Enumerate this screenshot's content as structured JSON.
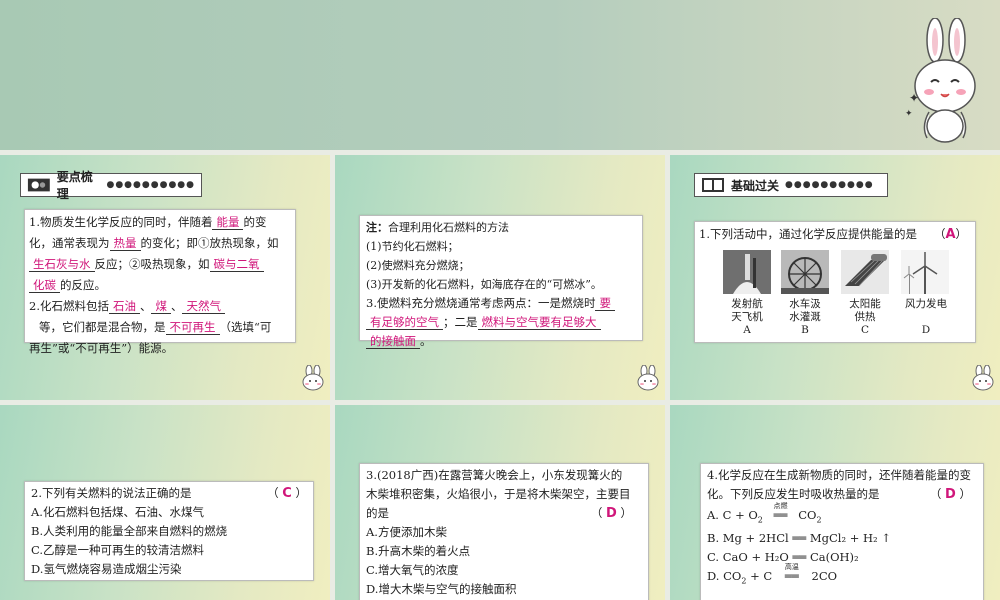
{
  "slide1": {
    "header": "要点梳理",
    "q1_pre": "1.物质发生化学反应的同时，伴随着",
    "q1_a1": "能量",
    "q1_mid1": "的变",
    "q1_line2_pre": "化，通常表现为",
    "q1_a2": "热量",
    "q1_line2_post": "的变化；即①放热现象，如",
    "q1_a3": "生石灰与水",
    "q1_line3_post": "反应；②吸热现象，如",
    "q1_a4": "碳与二氧",
    "q1_a4b": "化碳",
    "q1_line4_post": "的反应。",
    "q2_pre": "2.化石燃料包括",
    "q2_a1": "石油",
    "q2_sep1": "、",
    "q2_a2": "煤",
    "q2_sep2": "、",
    "q2_a3": "天然气",
    "q2_line2_pre": "等，它们都是混合物，是",
    "q2_a4": "不可再生",
    "q2_line2_post": "（选填“可",
    "q2_line3": "再生”或“不可再生”）能源。"
  },
  "slide2": {
    "note_label": "注：",
    "note_text": "合理利用化石燃料的方法",
    "item1": "(1)节约化石燃料；",
    "item2": "(2)使燃料充分燃烧；",
    "item3": "(3)开发新的化石燃料，如海底存在的“可燃冰”。",
    "q3_pre": "3.使燃料充分燃烧通常考虑两点：一是燃烧时",
    "q3_a1": "要",
    "q3_a1b": "有足够的空气",
    "q3_mid": "；二是",
    "q3_a2": "燃料与空气要有足够大",
    "q3_a2b": "的接触面",
    "q3_end": "。"
  },
  "slide3": {
    "header": "基础过关",
    "q1_text": "1.下列活动中，通过化学反应提供能量的是",
    "q1_answer": "A",
    "captions": [
      {
        "line1": "发射航",
        "line2": "天飞机",
        "letter": "A"
      },
      {
        "line1": "水车汲",
        "line2": "水灌溉",
        "letter": "B"
      },
      {
        "line1": "太阳能",
        "line2": "供热",
        "letter": "C"
      },
      {
        "line1": "风力发电",
        "line2": "",
        "letter": "D"
      }
    ]
  },
  "slide4": {
    "q_text": "2.下列有关燃料的说法正确的是",
    "answer": "C",
    "options": [
      "A.化石燃料包括煤、石油、水煤气",
      "B.人类利用的能量全部来自燃料的燃烧",
      "C.乙醇是一种可再生的较清洁燃料",
      "D.氢气燃烧容易造成烟尘污染"
    ]
  },
  "slide5": {
    "q_line1": "3.(2018广西)在露营篝火晚会上，小东发现篝火的",
    "q_line2": "木柴堆积密集，火焰很小，于是将木柴架空，主要目",
    "q_line3": "的是",
    "answer": "D",
    "options": [
      "A.方便添加木柴",
      "B.升高木柴的着火点",
      "C.增大氧气的浓度",
      "D.增大木柴与空气的接触面积"
    ]
  },
  "slide6": {
    "q_line1": "4.化学反应在生成新物质的同时，还伴随着能量的变",
    "q_line2": "化。下列反应发生时吸收热量的是",
    "answer": "D",
    "options": [
      {
        "pre": "A. C + O",
        "sub1": "2",
        "cond": "点燃",
        "post": "CO",
        "sub2": "2"
      },
      {
        "text": "B. Mg + 2HCl ══ MgCl₂ + H₂ ↑"
      },
      {
        "text": "C. CaO + H₂O ══ Ca(OH)₂"
      },
      {
        "pre": "D. CO",
        "sub1": "2",
        "mid": " + C ",
        "cond": "高温",
        "post": "2CO"
      }
    ]
  }
}
